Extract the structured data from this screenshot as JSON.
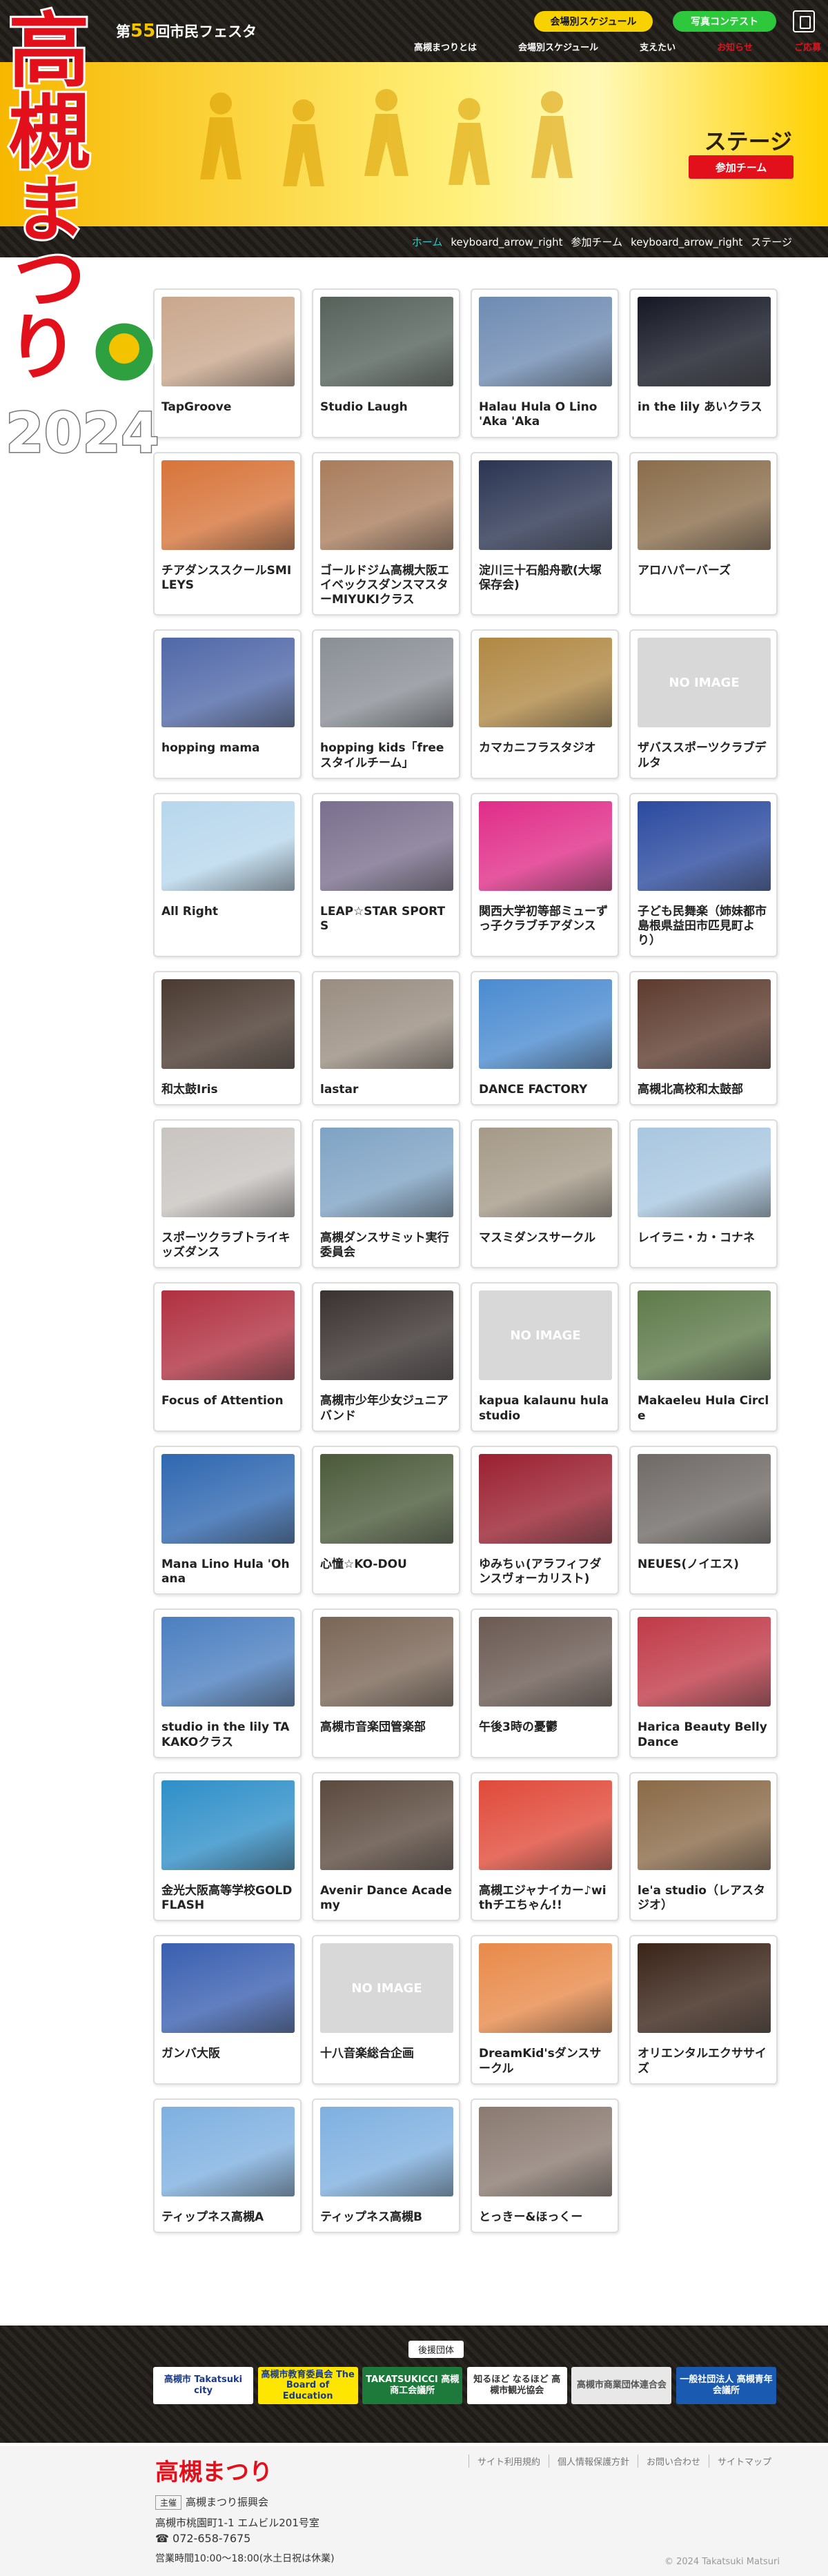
{
  "header": {
    "festival_prefix": "第",
    "festival_number": "55",
    "festival_suffix": "回市民フェスタ",
    "schedule_button": "会場別スケジュール",
    "photo_button": "写真コンテスト",
    "nav": [
      "高槻まつりとは",
      "会場別スケジュール",
      "支えたい",
      "お知らせ",
      "ご応募"
    ]
  },
  "logo": {
    "text1": "高槻",
    "text2": "まつり",
    "year": "2024"
  },
  "hero": {
    "title": "ステージ",
    "badge": "参加チーム"
  },
  "breadcrumb": {
    "home": "ホーム",
    "separator": "keyboard_arrow_right",
    "level1": "参加チーム",
    "level2": "ステージ"
  },
  "teams": [
    {
      "name": "TapGroove",
      "color": "#c9a78d"
    },
    {
      "name": "Studio Laugh",
      "color": "#55625a"
    },
    {
      "name": "Halau Hula O Lino 'Aka 'Aka",
      "color": "#6e8bb2"
    },
    {
      "name": "in the lily あいクラス",
      "color": "#151824"
    },
    {
      "name": "チアダンススクールSMILEYS",
      "color": "#d7743a"
    },
    {
      "name": "ゴールドジム高槻大阪エイベックスダンスマスターMIYUKIクラス",
      "color": "#a97d5d"
    },
    {
      "name": "淀川三十石船舟歌(大塚保存会)",
      "color": "#2b3552"
    },
    {
      "name": "アロハパーバーズ",
      "color": "#8a6d4b"
    },
    {
      "name": "hopping mama",
      "color": "#5068a8"
    },
    {
      "name": "hopping kids「freeスタイルチーム」",
      "color": "#8a8f96"
    },
    {
      "name": "カマカニフラスタジオ",
      "color": "#b08844"
    },
    {
      "name": "ザバススポーツクラブデルタ",
      "color": "#d8d8d8"
    },
    {
      "name": "All Right",
      "color": "#b8d7ec"
    },
    {
      "name": "LEAP☆STAR SPORTS",
      "color": "#7a6f8d"
    },
    {
      "name": "関西大学初等部ミューずっ子クラブチアダンス",
      "color": "#e02d88"
    },
    {
      "name": "子ども民舞楽（姉妹都市島根県益田市匹見町より）",
      "color": "#2b4a9f"
    },
    {
      "name": "和太鼓Iris",
      "color": "#4a3a30"
    },
    {
      "name": "lastar",
      "color": "#998d80"
    },
    {
      "name": "DANCE FACTORY",
      "color": "#4b8bd0"
    },
    {
      "name": "高槻北高校和太鼓部",
      "color": "#5d3b2e"
    },
    {
      "name": "スポーツクラブトライキッズダンス",
      "color": "#c8c4c0"
    },
    {
      "name": "高槻ダンスサミット実行委員会",
      "color": "#7fa3c4"
    },
    {
      "name": "マスミダンスサークル",
      "color": "#a59a88"
    },
    {
      "name": "レイラニ・カ・コナネ",
      "color": "#a9c7e0"
    },
    {
      "name": "Focus of Attention",
      "color": "#b03040"
    },
    {
      "name": "高槻市少年少女ジュニアバンド",
      "color": "#3a3230"
    },
    {
      "name": "kapua kalaunu hula studio",
      "color": "#d8d8d8"
    },
    {
      "name": "Makaeleu Hula Circle",
      "color": "#5e7a4a"
    },
    {
      "name": "Mana Lino Hula 'Ohana",
      "color": "#2f67b0"
    },
    {
      "name": "心憧☆KO-DOU",
      "color": "#4b5a3a"
    },
    {
      "name": "ゆみちぃ(アラフィフダンスヴォーカリスト)",
      "color": "#9a2030"
    },
    {
      "name": "NEUES(ノイエス)",
      "color": "#6f6a66"
    },
    {
      "name": "studio in the lily TAKAKOクラス",
      "color": "#4c7fc0"
    },
    {
      "name": "高槻市音楽団管楽部",
      "color": "#7a6656"
    },
    {
      "name": "午後3時の憂鬱",
      "color": "#6a5a52"
    },
    {
      "name": "Harica Beauty Belly Dance",
      "color": "#c03a48"
    },
    {
      "name": "金光大阪高等学校GOLD FLASH",
      "color": "#2f8fc8"
    },
    {
      "name": "Avenir Dance Academy",
      "color": "#5b4a3e"
    },
    {
      "name": "高槻エジャナイカー♪withチエちゃん!!",
      "color": "#e04a3a"
    },
    {
      "name": "le'a studio（レアスタジオ）",
      "color": "#8a6a48"
    },
    {
      "name": "ガンバ大阪",
      "color": "#3a5fb0"
    },
    {
      "name": "十八音楽総合企画",
      "color": "#d8d8d8"
    },
    {
      "name": "DreamKid'sダンスサークル",
      "color": "#e88a4a"
    },
    {
      "name": "オリエンタルエクササイズ",
      "color": "#3a2418"
    },
    {
      "name": "ティップネス高槻A",
      "color": "#7fb0e0"
    },
    {
      "name": "ティップネス高槻B",
      "color": "#7fb0e0"
    },
    {
      "name": "とっきー&ほっくー",
      "color": "#8a7a70"
    }
  ],
  "no_image": "NO IMAGE",
  "no_image_indices": [
    11,
    26,
    41
  ],
  "sponsors_label": "後援団体",
  "sponsors": [
    {
      "name": "高槻市 Takatsuki city",
      "bg": "#ffffff",
      "fg": "#1a3a8a"
    },
    {
      "name": "高槻市教育委員会 The Board of Education",
      "bg": "#ffe600",
      "fg": "#1a3a8a"
    },
    {
      "name": "TAKATSUKICCI 高槻商工会議所",
      "bg": "#1d7a3a",
      "fg": "#ffffff"
    },
    {
      "name": "知るほど なるほど 高槻市観光協会",
      "bg": "#ffffff",
      "fg": "#333333"
    },
    {
      "name": "高槻市商業団体連合会",
      "bg": "#e8e8e8",
      "fg": "#555555"
    },
    {
      "name": "一般社団法人 高槻青年会議所",
      "bg": "#1a5ab0",
      "fg": "#ffffff"
    }
  ],
  "footer": {
    "logo": "高槻まつり",
    "links": [
      "サイト利用規約",
      "個人情報保護方針",
      "お問い合わせ",
      "サイトマップ"
    ],
    "org_tag": "主催",
    "org_name": "高槻まつり振興会",
    "address": "高槻市桃園町1-1 エムビル201号室",
    "tel": "072-658-7675",
    "hours": "営業時間10:00〜18:00(水土日祝は休業)",
    "copyright": "© 2024 Takatsuki Matsuri"
  }
}
